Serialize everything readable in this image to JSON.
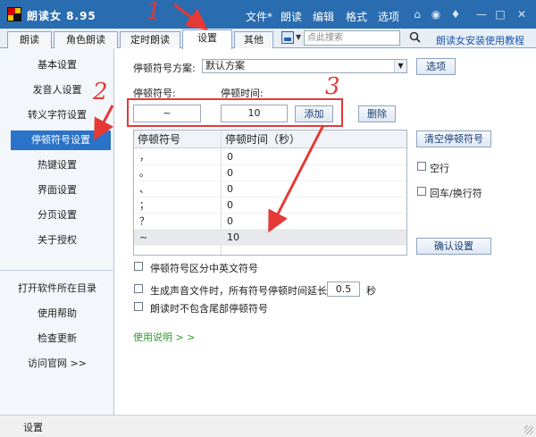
{
  "app": {
    "name": "朗读女 8.95"
  },
  "menu": [
    "文件*",
    "朗读",
    "编辑",
    "格式",
    "选项"
  ],
  "tabs": [
    "朗读",
    "角色朗读",
    "定时朗读",
    "设置",
    "其他"
  ],
  "search": {
    "placeholder": "点此搜索"
  },
  "tutorial_link": "朗读女安装使用教程",
  "sidebar": {
    "items": [
      "基本设置",
      "发音人设置",
      "转义字符设置",
      "停顿符号设置",
      "热键设置",
      "界面设置",
      "分页设置",
      "关于授权"
    ],
    "tools": [
      "打开软件所在目录",
      "使用帮助",
      "检查更新",
      "访问官网 >>"
    ]
  },
  "scheme": {
    "label": "停顿符号方案:",
    "value": "默认方案",
    "button": "选项"
  },
  "symbol_input": {
    "label": "停顿符号:",
    "value": "~"
  },
  "time_input": {
    "label": "停顿时间:",
    "value": "10"
  },
  "buttons": {
    "add": "添加",
    "delete": "删除",
    "clear": "清空停顿符号",
    "confirm": "确认设置"
  },
  "table": {
    "headers": [
      "停顿符号",
      "停顿时间（秒）"
    ],
    "rows": [
      {
        "symbol": "，",
        "time": "0"
      },
      {
        "symbol": "。",
        "time": "0"
      },
      {
        "symbol": "、",
        "time": "0"
      },
      {
        "symbol": "；",
        "time": "0"
      },
      {
        "symbol": "？",
        "time": "0"
      },
      {
        "symbol": "~",
        "time": "10"
      }
    ]
  },
  "side_options": {
    "space": "空行",
    "newline": "回车/换行符"
  },
  "options": {
    "distinguish": "停顿符号区分中英文符号",
    "extend_prefix": "生成声音文件时，所有符号停顿时间延长",
    "extend_value": "0.5",
    "extend_unit": "秒",
    "exclude_tail": "朗读时不包含尾部停顿符号"
  },
  "help_link": "使用说明 > >",
  "status": "设置",
  "annotations": [
    "1",
    "2",
    "3"
  ],
  "colors": {
    "titlebar": "#2a6cb0",
    "accent": "#2a73c8",
    "annotation": "#e53935",
    "link": "#1a56b0",
    "help_link": "#2b9b2b"
  }
}
